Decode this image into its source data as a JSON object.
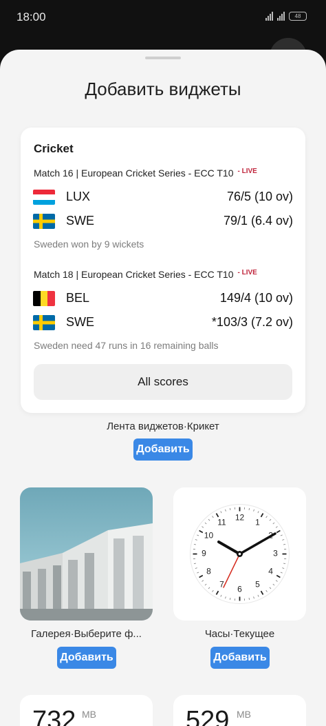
{
  "status": {
    "time": "18:00",
    "battery": "48"
  },
  "sheet": {
    "title": "Добавить виджеты"
  },
  "cricket": {
    "title": "Cricket",
    "matches": [
      {
        "header": "Match 16 | European Cricket Series - ECC T10",
        "live": "- LIVE",
        "teams": [
          {
            "name": "LUX",
            "score": "76/5 (10 ov)"
          },
          {
            "name": "SWE",
            "score": "79/1 (6.4 ov)"
          }
        ],
        "note": "Sweden won by 9 wickets"
      },
      {
        "header": "Match 18 | European Cricket Series - ECC T10",
        "live": "- LIVE",
        "teams": [
          {
            "name": "BEL",
            "score": "149/4 (10 ov)"
          },
          {
            "name": "SWE",
            "score": "*103/3 (7.2 ov)"
          }
        ],
        "note": "Sweden need 47 runs in 16 remaining balls"
      }
    ],
    "all_scores_label": "All scores",
    "live_color": "#c0263d"
  },
  "widgets": {
    "cricket_label": "Лента виджетов·Крикет",
    "gallery_label": "Галерея·Выберите ф...",
    "clock_label": "Часы·Текущее",
    "add_label": "Добавить",
    "accent": "#3a88e6"
  },
  "clock": {
    "numbers": [
      "12",
      "1",
      "2",
      "3",
      "4",
      "5",
      "6",
      "7",
      "8",
      "9",
      "10",
      "11"
    ]
  },
  "memory": [
    {
      "value": "732",
      "unit": "MB"
    },
    {
      "value": "529",
      "unit": "MB"
    }
  ]
}
